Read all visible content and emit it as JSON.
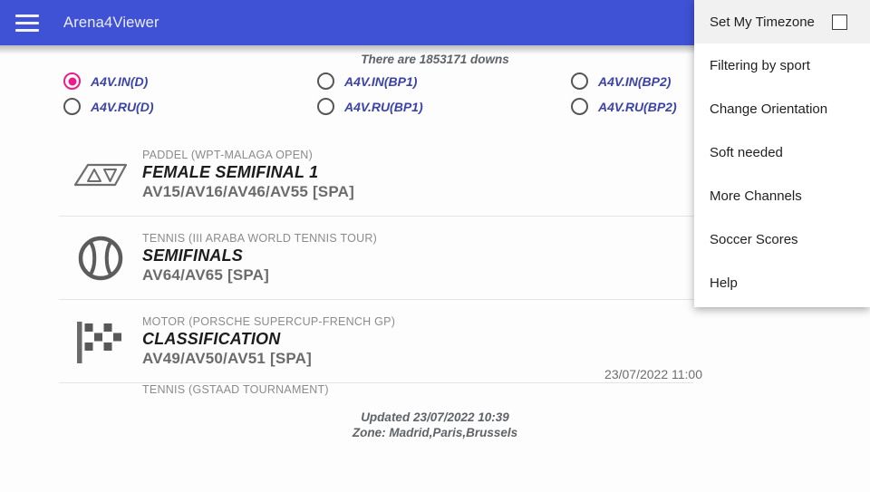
{
  "appbar": {
    "menu_icon": "hamburger-icon",
    "title": "Arena4Viewer"
  },
  "status": {
    "downs_text": "There are 1853171 downs"
  },
  "radios": [
    {
      "label": "A4V.IN(D)",
      "selected": true
    },
    {
      "label": "A4V.IN(BP1)",
      "selected": false
    },
    {
      "label": "A4V.IN(BP2)",
      "selected": false
    },
    {
      "label": "A4V.RU(D)",
      "selected": false
    },
    {
      "label": "A4V.RU(BP1)",
      "selected": false
    },
    {
      "label": "A4V.RU(BP2)",
      "selected": false
    }
  ],
  "events": [
    {
      "icon": "paddle-icon",
      "category": "PADDEL (WPT-MALAGA OPEN)",
      "title": "FEMALE SEMIFINAL 1",
      "channels": "AV15/AV16/AV46/AV55 [SPA]"
    },
    {
      "icon": "tennis-ball-icon",
      "category": "TENNIS (III ARABA WORLD TENNIS TOUR)",
      "title": "SEMIFINALS",
      "channels": "AV64/AV65 [SPA]"
    },
    {
      "icon": "checkered-flag-icon",
      "category": "MOTOR (PORSCHE SUPERCUP-FRENCH GP)",
      "title": "CLASSIFICATION",
      "channels": "AV49/AV50/AV51 [SPA]"
    },
    {
      "icon": "tennis-ball-icon",
      "category": "TENNIS (GSTAAD TOURNAMENT)",
      "title": "",
      "channels": ""
    }
  ],
  "timestamp": "23/07/2022 11:00",
  "footer": {
    "updated": "Updated 23/07/2022 10:39",
    "zone": "Zone: Madrid,Paris,Brussels"
  },
  "menu": {
    "items": [
      {
        "label": "Set My Timezone",
        "checkbox": true,
        "checked": false
      },
      {
        "label": "Filtering by sport",
        "checkbox": false
      },
      {
        "label": "Change Orientation",
        "checkbox": false
      },
      {
        "label": "Soft needed",
        "checkbox": false
      },
      {
        "label": "More Channels",
        "checkbox": false
      },
      {
        "label": "Soccer Scores",
        "checkbox": false
      },
      {
        "label": "Help",
        "checkbox": false
      }
    ]
  },
  "colors": {
    "appbar": "#3f51d5",
    "accent_selected": "#e91e8c",
    "radio_label": "#3b43a8"
  }
}
